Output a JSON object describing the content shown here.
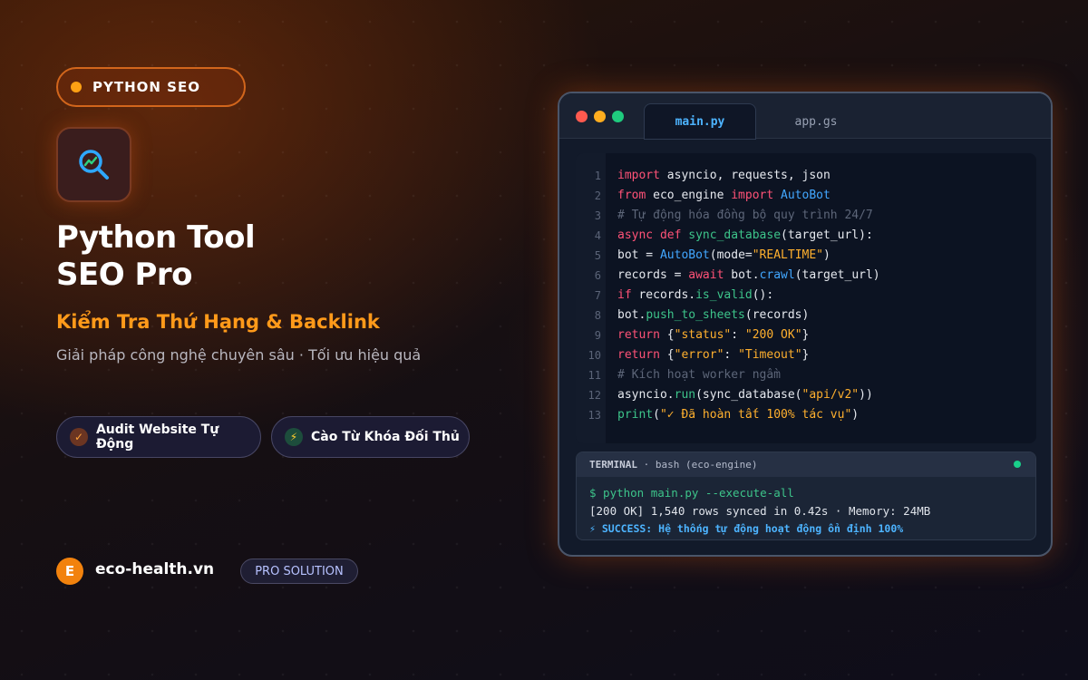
{
  "badge": {
    "label": "PYTHON SEO"
  },
  "hero": {
    "title_line1": "Python Tool",
    "title_line2": "SEO Pro",
    "subtitle": "Kiểm Tra Thứ Hạng & Backlink",
    "description": "Giải pháp công nghệ chuyên sâu · Tối ưu hiệu quả"
  },
  "features": [
    {
      "icon": "check-icon",
      "label": "Audit Website Tự Động"
    },
    {
      "icon": "lightning-icon",
      "label": "Cào Từ Khóa Đối Thủ"
    }
  ],
  "brand": {
    "initial": "E",
    "name": "eco-health.vn",
    "tag": "PRO SOLUTION"
  },
  "editor": {
    "tabs": [
      {
        "label": "main.py",
        "active": true
      },
      {
        "label": "app.gs",
        "active": false
      }
    ],
    "code_lines": [
      {
        "n": "1",
        "tokens": [
          [
            "kw",
            "import"
          ],
          [
            "tx",
            " asyncio, requests, json"
          ]
        ]
      },
      {
        "n": "2",
        "tokens": [
          [
            "kw",
            "from"
          ],
          [
            "tx",
            " eco_engine "
          ],
          [
            "kw",
            "import"
          ],
          [
            "tx",
            " "
          ],
          [
            "cl",
            "AutoBot"
          ]
        ]
      },
      {
        "n": "3",
        "tokens": [
          [
            "cm",
            "# Tự động hóa đồng bộ quy trình 24/7"
          ]
        ]
      },
      {
        "n": "4",
        "tokens": [
          [
            "kw",
            "async def"
          ],
          [
            "tx",
            " "
          ],
          [
            "fn",
            "sync_database"
          ],
          [
            "tx",
            "(target_url):"
          ]
        ]
      },
      {
        "n": "5",
        "tokens": [
          [
            "tx",
            "bot = "
          ],
          [
            "cl",
            "AutoBot"
          ],
          [
            "tx",
            "(mode="
          ],
          [
            "st",
            "\"REALTIME\""
          ],
          [
            "tx",
            ")"
          ]
        ]
      },
      {
        "n": "6",
        "tokens": [
          [
            "tx",
            "records = "
          ],
          [
            "kw",
            "await"
          ],
          [
            "tx",
            " bot."
          ],
          [
            "cl",
            "crawl"
          ],
          [
            "tx",
            "(target_url)"
          ]
        ]
      },
      {
        "n": "7",
        "tokens": [
          [
            "kw",
            "if"
          ],
          [
            "tx",
            " records."
          ],
          [
            "fn",
            "is_valid"
          ],
          [
            "tx",
            "():"
          ]
        ]
      },
      {
        "n": "8",
        "tokens": [
          [
            "tx",
            "bot."
          ],
          [
            "fn",
            "push_to_sheets"
          ],
          [
            "tx",
            "(records)"
          ]
        ]
      },
      {
        "n": "9",
        "tokens": [
          [
            "kw",
            "return"
          ],
          [
            "tx",
            " {"
          ],
          [
            "st",
            "\"status\""
          ],
          [
            "tx",
            ": "
          ],
          [
            "st",
            "\"200 OK\""
          ],
          [
            "tx",
            "}"
          ]
        ]
      },
      {
        "n": "10",
        "tokens": [
          [
            "kw",
            "return"
          ],
          [
            "tx",
            " {"
          ],
          [
            "st",
            "\"error\""
          ],
          [
            "tx",
            ": "
          ],
          [
            "st",
            "\"Timeout\""
          ],
          [
            "tx",
            "}"
          ]
        ]
      },
      {
        "n": "11",
        "tokens": [
          [
            "cm",
            "# Kích hoạt worker ngầm"
          ]
        ]
      },
      {
        "n": "12",
        "tokens": [
          [
            "tx",
            "asyncio."
          ],
          [
            "fn",
            "run"
          ],
          [
            "tx",
            "(sync_database("
          ],
          [
            "st",
            "\"api/v2\""
          ],
          [
            "tx",
            "))"
          ]
        ]
      },
      {
        "n": "13",
        "tokens": [
          [
            "fn",
            "print"
          ],
          [
            "tx",
            "("
          ],
          [
            "st",
            "\"✓ Đã hoàn tất 100% tác vụ\""
          ],
          [
            "tx",
            ")"
          ]
        ]
      }
    ]
  },
  "terminal": {
    "title": "TERMINAL",
    "session": "· bash (eco-engine)",
    "lines": [
      "$ python main.py --execute-all",
      "[200 OK] 1,540 rows synced in 0.42s · Memory: 24MB",
      "⚡ SUCCESS: Hệ thống tự động hoạt động ổn định 100%"
    ]
  },
  "colors": {
    "accent": "#ff9a1a",
    "keyword": "#ff5277",
    "function": "#3dc48a",
    "class": "#42a7ff",
    "string": "#ffb02e",
    "comment": "#5d6679",
    "success": "#4db4ff"
  }
}
